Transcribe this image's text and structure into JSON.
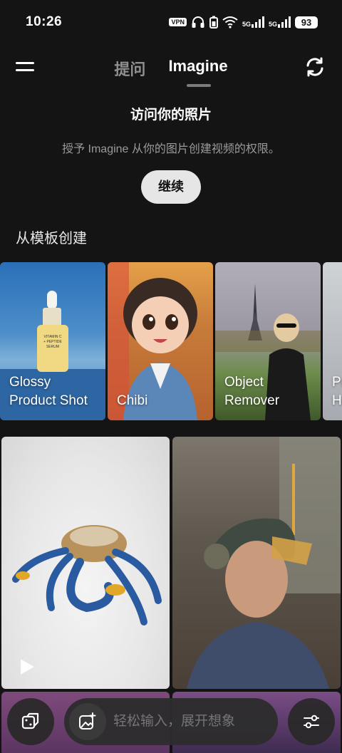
{
  "status_bar": {
    "time": "10:26",
    "vpn": "VPN",
    "sig1": "5G",
    "sig2": "5G",
    "battery": "93"
  },
  "nav": {
    "tabs": [
      {
        "label": "提问",
        "active": false
      },
      {
        "label": "Imagine",
        "active": true
      }
    ],
    "icons": {
      "menu": "hamburger-menu-icon",
      "refresh": "refresh-icon"
    }
  },
  "access": {
    "title": "访问你的照片",
    "description": "授予 Imagine 从你的图片创建视频的权限。",
    "continue_label": "继续"
  },
  "templates": {
    "title": "从模板创建",
    "items": [
      {
        "line1": "Glossy",
        "line2": "Product Shot"
      },
      {
        "line1": "Chibi",
        "line2": ""
      },
      {
        "line1": "Object",
        "line2": "Remover"
      },
      {
        "line1": "Pr",
        "line2": "He"
      }
    ],
    "product_label": [
      "VITAMIN C",
      "+ PEPTIDE",
      "SERUM"
    ]
  },
  "gallery": {
    "items": [
      "crab",
      "man-with-headset",
      "purple-1",
      "purple-2"
    ]
  },
  "bottom": {
    "prompt_placeholder": "轻松输入，展开想象",
    "icons": {
      "left": "dice-icon",
      "prompt": "image-add-icon",
      "right": "sliders-icon"
    }
  },
  "colors": {
    "background": "#141414",
    "accent": "#ffffff",
    "muted": "#9a9a9a"
  }
}
